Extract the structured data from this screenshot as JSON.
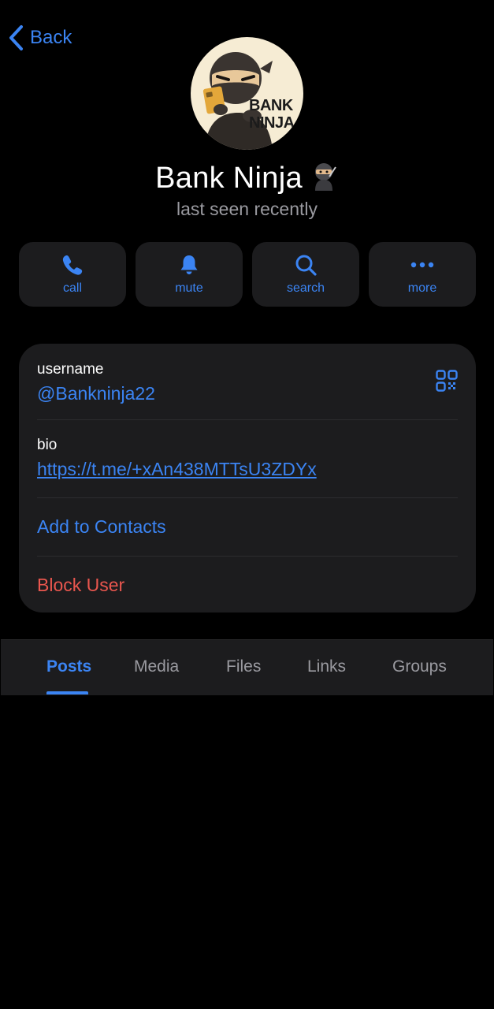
{
  "header": {
    "back_label": "Back"
  },
  "profile": {
    "name": "Bank Ninja",
    "name_emoji": "ninja",
    "status": "last seen recently",
    "avatar_text_line1": "BANK",
    "avatar_text_line2": "NINJA"
  },
  "actions": [
    {
      "label": "call",
      "icon": "phone-icon"
    },
    {
      "label": "mute",
      "icon": "bell-icon"
    },
    {
      "label": "search",
      "icon": "search-icon"
    },
    {
      "label": "more",
      "icon": "more-icon"
    }
  ],
  "info": {
    "username_label": "username",
    "username_value": "@Bankninja22",
    "bio_label": "bio",
    "bio_value": "https://t.me/+xAn438MTTsU3ZDYx",
    "add_contacts": "Add to Contacts",
    "block_user": "Block User"
  },
  "tabs": [
    {
      "label": "Posts",
      "active": true
    },
    {
      "label": "Media"
    },
    {
      "label": "Files"
    },
    {
      "label": "Links"
    },
    {
      "label": "Groups"
    }
  ],
  "colors": {
    "accent": "#3b84f3",
    "danger": "#e9564e",
    "card": "#1c1c1e",
    "background": "#000000"
  }
}
